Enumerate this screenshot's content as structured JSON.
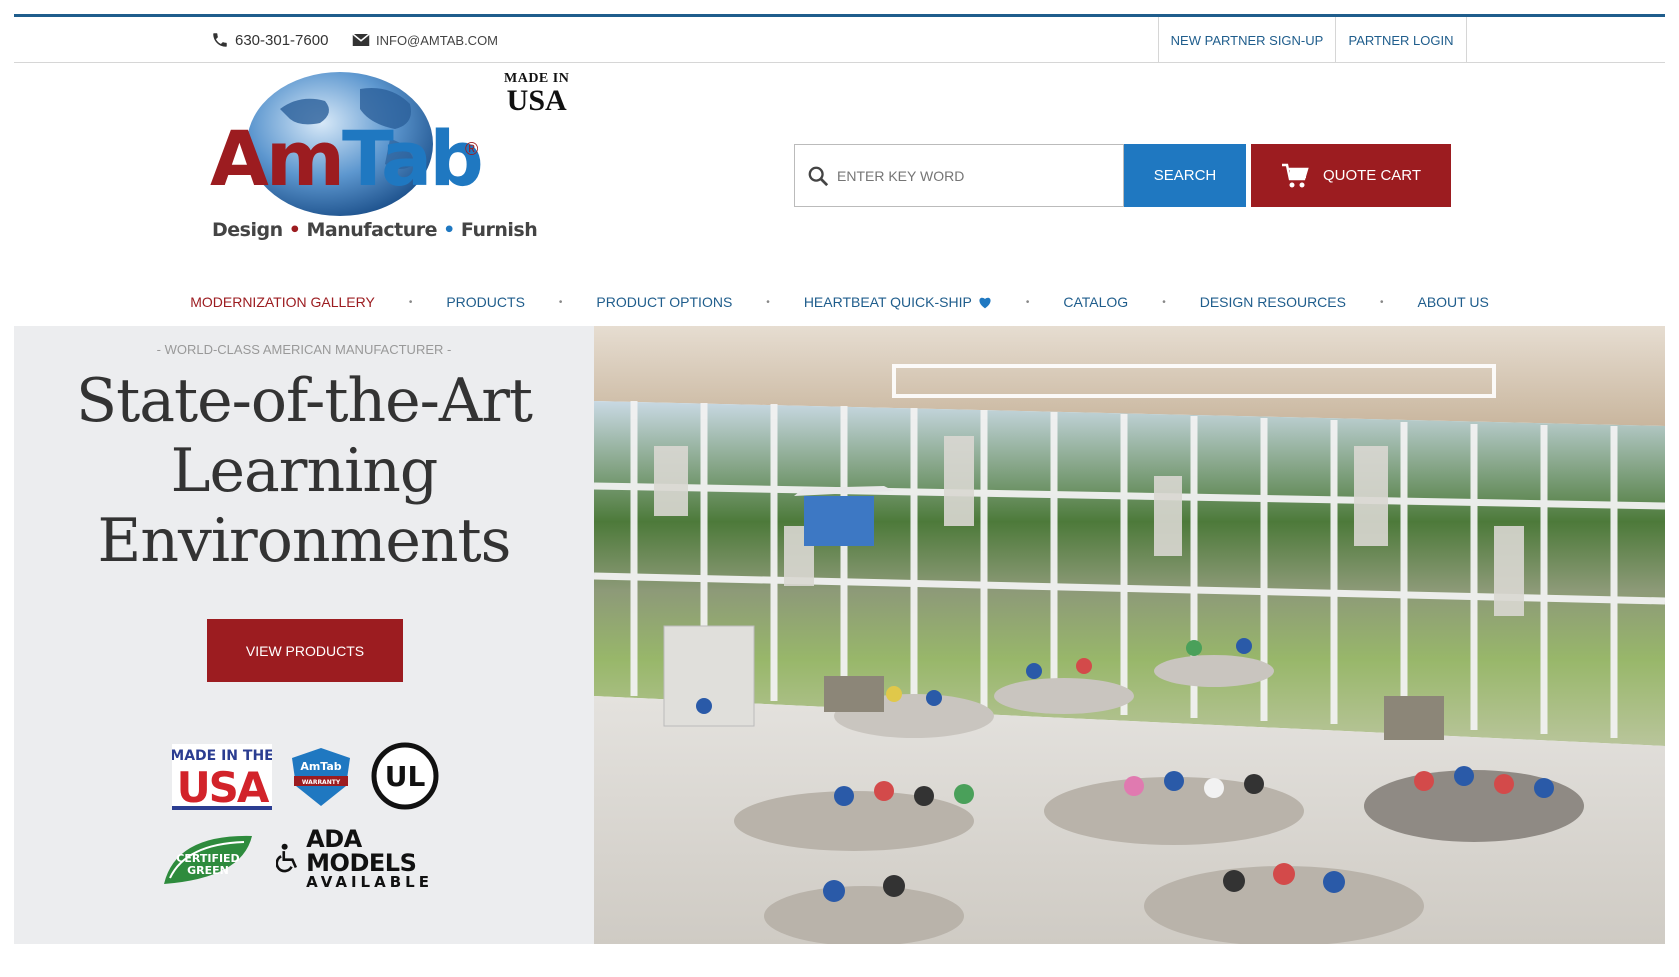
{
  "topbar": {
    "phone": "630-301-7600",
    "email": "INFO@AMTAB.COM",
    "signup_label": "NEW PARTNER SIGN-UP",
    "login_label": "PARTNER LOGIN"
  },
  "brand": {
    "logo_text": "AmTab",
    "registered": "®",
    "slogan": [
      "Design",
      "Manufacture",
      "Furnish"
    ],
    "made_in_line1": "MADE IN",
    "made_in_line2": "USA"
  },
  "search": {
    "placeholder": "ENTER KEY WORD",
    "button_label": "SEARCH"
  },
  "cart": {
    "label": "QUOTE CART"
  },
  "nav": {
    "items": [
      {
        "label": "MODERNIZATION GALLERY"
      },
      {
        "label": "PRODUCTS"
      },
      {
        "label": "PRODUCT OPTIONS"
      },
      {
        "label": "HEARTBEAT QUICK-SHIP"
      },
      {
        "label": "CATALOG"
      },
      {
        "label": "DESIGN RESOURCES"
      },
      {
        "label": "ABOUT US"
      }
    ],
    "separator": "•"
  },
  "hero": {
    "tagline": "- WORLD-CLASS AMERICAN MANUFACTURER -",
    "headline_lines": [
      "State-of-the-Art",
      "Learning",
      "Environments"
    ],
    "cta_label": "VIEW PRODUCTS",
    "badges": {
      "usa_line1": "MADE IN THE",
      "usa_line2": "USA",
      "warranty_brand": "AmTab",
      "warranty_text": "WARRANTY",
      "ul_text": "UL",
      "green_line1": "CERTIFIED",
      "green_line2": "GREEN",
      "ada_line1": "ADA MODELS",
      "ada_line2": "AVAILABLE"
    }
  },
  "colors": {
    "accent_blue": "#1f78c1",
    "nav_blue": "#1f5d8c",
    "brand_red": "#9c1c20",
    "hero_bg": "#ecedef"
  }
}
